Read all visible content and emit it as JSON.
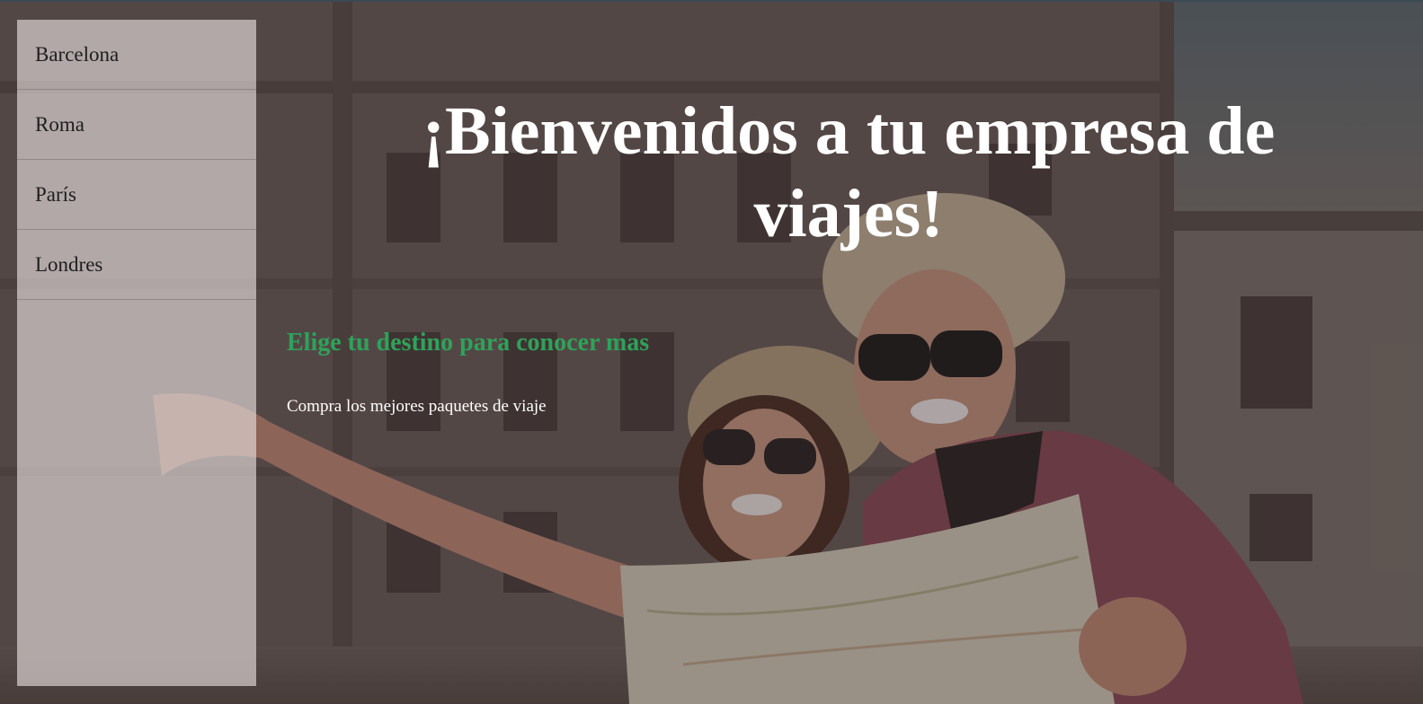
{
  "sidebar": {
    "items": [
      {
        "label": "Barcelona"
      },
      {
        "label": "Roma"
      },
      {
        "label": "París"
      },
      {
        "label": "Londres"
      }
    ]
  },
  "hero": {
    "title": "¡Bienvenidos a tu empresa de viajes!",
    "subtitle": "Elige tu destino para conocer mas",
    "tagline": "Compra los mejores paquetes de viaje"
  },
  "colors": {
    "subtitle": "#2fa25a",
    "title": "#ffffff",
    "sidebar_bg": "rgba(235,228,228,0.62)"
  }
}
